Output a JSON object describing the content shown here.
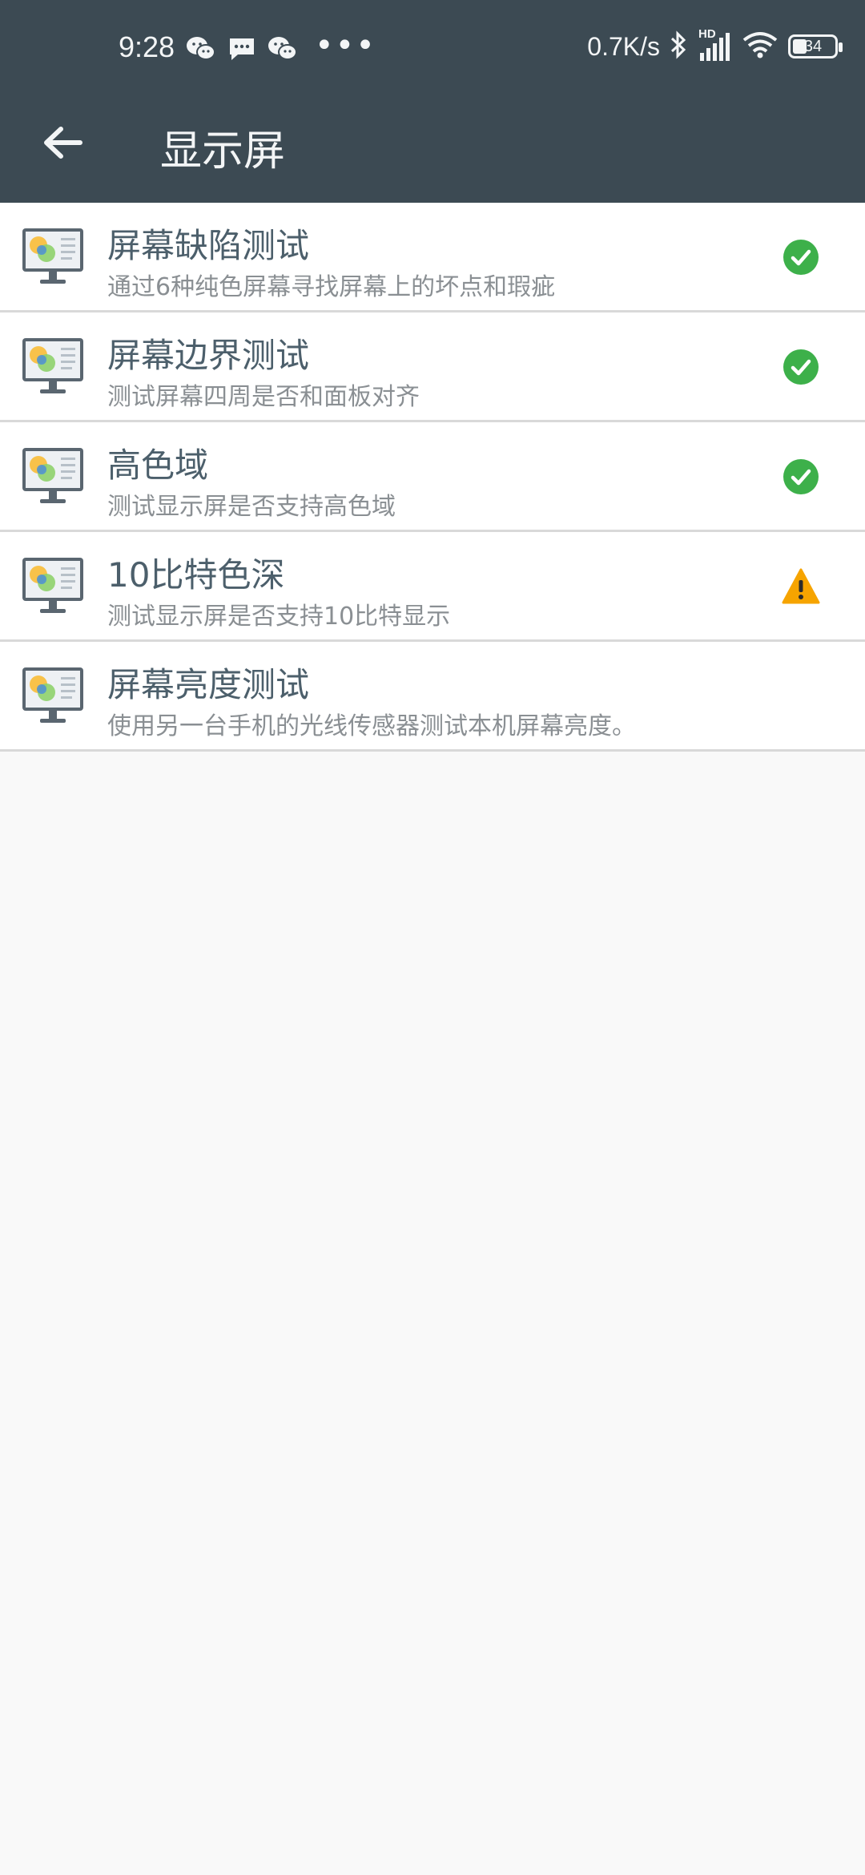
{
  "status_bar": {
    "time": "9:28",
    "net_speed": "0.7K/s",
    "battery_level": "34",
    "battery_percent": 34,
    "signal_badge": "HD",
    "left_icons": [
      "wechat-icon",
      "message-icon",
      "wechat-icon"
    ],
    "right_icons": [
      "bluetooth-icon",
      "cellular-signal-icon",
      "wifi-icon",
      "battery-icon"
    ]
  },
  "appbar": {
    "title": "显示屏",
    "back_icon": "arrow-left-icon",
    "background": "#3c4a53"
  },
  "items": [
    {
      "title": "屏幕缺陷测试",
      "subtitle": "通过6种纯色屏幕寻找屏幕上的坏点和瑕疵",
      "status": "pass",
      "icon": "monitor-color-icon"
    },
    {
      "title": "屏幕边界测试",
      "subtitle": "测试屏幕四周是否和面板对齐",
      "status": "pass",
      "icon": "monitor-color-icon"
    },
    {
      "title": "高色域",
      "subtitle": "测试显示屏是否支持高色域",
      "status": "pass",
      "icon": "monitor-color-icon"
    },
    {
      "title": "10比特色深",
      "subtitle": "测试显示屏是否支持10比特显示",
      "status": "warning",
      "icon": "monitor-color-icon"
    },
    {
      "title": "屏幕亮度测试",
      "subtitle": "使用另一台手机的光线传感器测试本机屏幕亮度。",
      "status": "none",
      "icon": "monitor-color-icon"
    }
  ],
  "colors": {
    "pass": "#3db04a",
    "warning": "#f6a400",
    "title_text": "#4c5f6b",
    "subtitle_text": "#8a8f93"
  }
}
